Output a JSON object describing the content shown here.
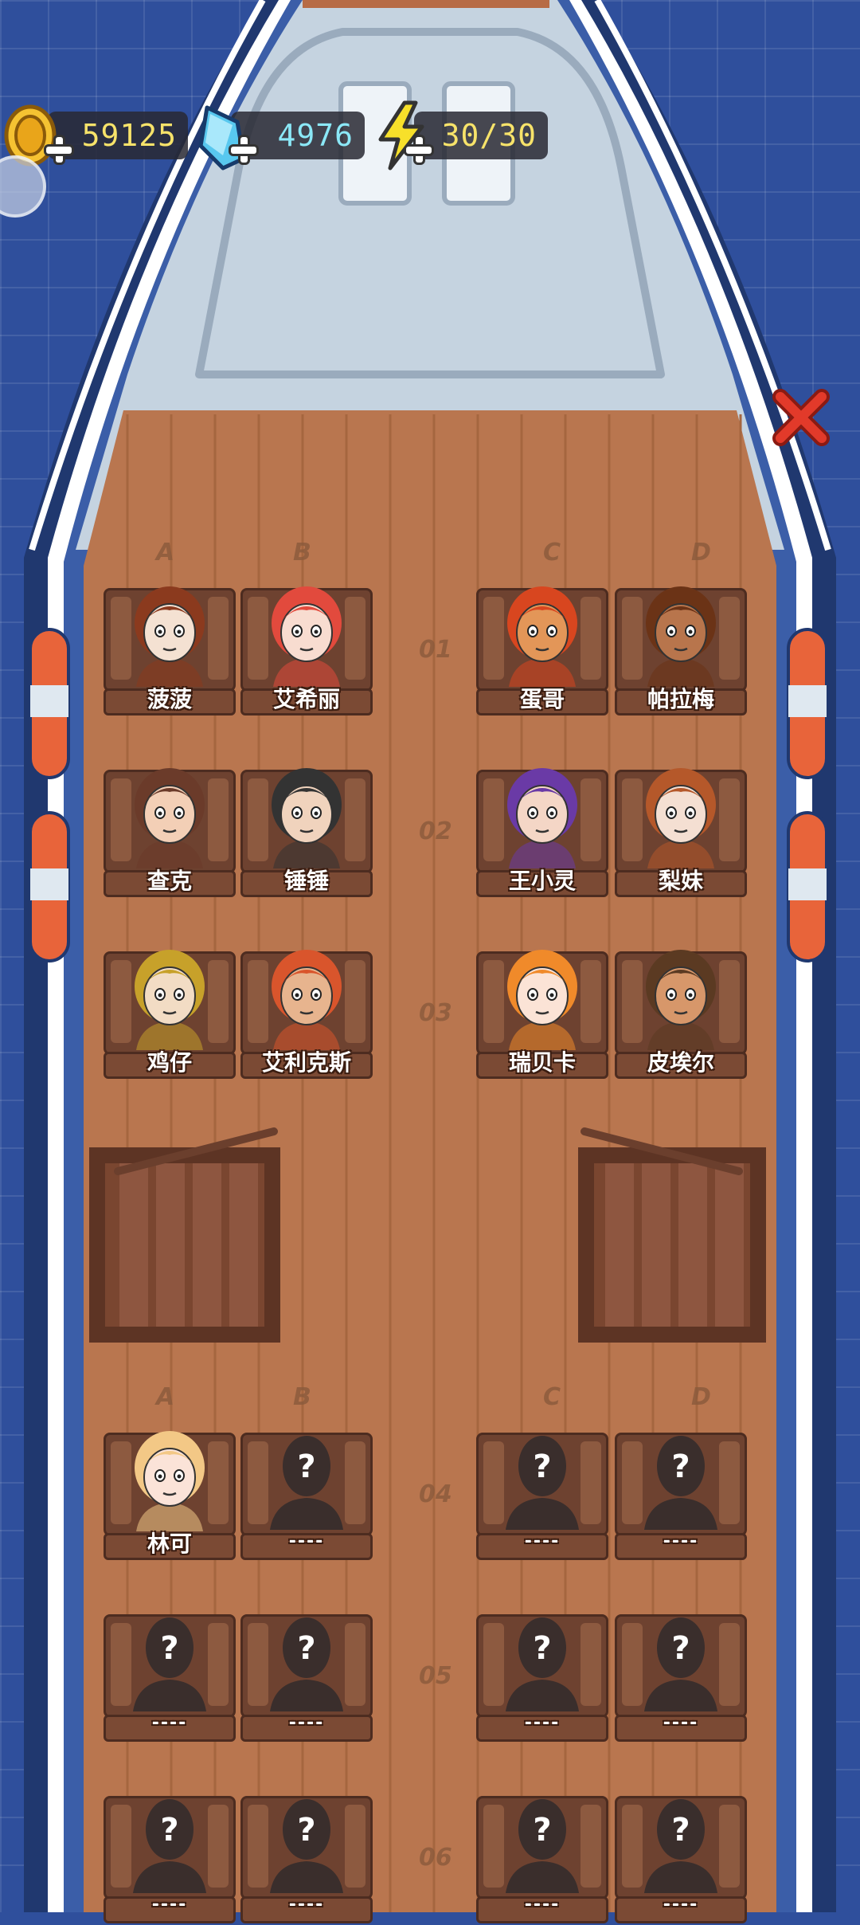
{
  "resources": {
    "coins": "59125",
    "gems": "4976",
    "energy": "30/30"
  },
  "deck": {
    "columns_top": [
      "A",
      "B",
      "C",
      "D"
    ],
    "columns_bottom": [
      "A",
      "B",
      "C",
      "D"
    ],
    "rows": [
      "01",
      "02",
      "03",
      "04",
      "05",
      "06"
    ],
    "seats": [
      {
        "row": "01",
        "col": "A",
        "name": "菠菠",
        "hair": "#8b3a1e",
        "skin": "#f4e1d2",
        "locked": false
      },
      {
        "row": "01",
        "col": "B",
        "name": "艾希丽",
        "hair": "#e24a3d",
        "skin": "#f8dcd0",
        "locked": false
      },
      {
        "row": "01",
        "col": "C",
        "name": "蛋哥",
        "hair": "#d8461f",
        "skin": "#e39658",
        "locked": false
      },
      {
        "row": "01",
        "col": "D",
        "name": "帕拉梅",
        "hair": "#6b3316",
        "skin": "#b8754c",
        "locked": false
      },
      {
        "row": "02",
        "col": "A",
        "name": "查克",
        "hair": "#6b3b2a",
        "skin": "#f3cfb6",
        "locked": false
      },
      {
        "row": "02",
        "col": "B",
        "name": "锤锤",
        "hair": "#333333",
        "skin": "#f0d3bd",
        "locked": false
      },
      {
        "row": "02",
        "col": "C",
        "name": "王小灵",
        "hair": "#6a3aa6",
        "skin": "#f4d6c6",
        "locked": false
      },
      {
        "row": "02",
        "col": "D",
        "name": "梨妹",
        "hair": "#b5582a",
        "skin": "#f4dfd2",
        "locked": false
      },
      {
        "row": "03",
        "col": "A",
        "name": "鸡仔",
        "hair": "#c7a12a",
        "skin": "#f2dcc4",
        "locked": false
      },
      {
        "row": "03",
        "col": "B",
        "name": "艾利克斯",
        "hair": "#d9552c",
        "skin": "#e7b48e",
        "locked": false
      },
      {
        "row": "03",
        "col": "C",
        "name": "瑞贝卡",
        "hair": "#f08a2a",
        "skin": "#fbe3d6",
        "locked": false
      },
      {
        "row": "03",
        "col": "D",
        "name": "皮埃尔",
        "hair": "#5b3a22",
        "skin": "#d7976a",
        "locked": false
      },
      {
        "row": "04",
        "col": "A",
        "name": "林可",
        "hair": "#f3c886",
        "skin": "#fbe3d8",
        "locked": false
      },
      {
        "row": "04",
        "col": "B",
        "name": "----",
        "locked": true
      },
      {
        "row": "04",
        "col": "C",
        "name": "----",
        "locked": true
      },
      {
        "row": "04",
        "col": "D",
        "name": "----",
        "locked": true
      },
      {
        "row": "05",
        "col": "A",
        "name": "----",
        "locked": true
      },
      {
        "row": "05",
        "col": "B",
        "name": "----",
        "locked": true
      },
      {
        "row": "05",
        "col": "C",
        "name": "----",
        "locked": true
      },
      {
        "row": "05",
        "col": "D",
        "name": "----",
        "locked": true
      },
      {
        "row": "06",
        "col": "A",
        "name": "----",
        "locked": true
      },
      {
        "row": "06",
        "col": "B",
        "name": "----",
        "locked": true
      },
      {
        "row": "06",
        "col": "C",
        "name": "----",
        "locked": true
      },
      {
        "row": "06",
        "col": "D",
        "name": "----",
        "locked": true
      }
    ]
  },
  "icons": {
    "coin": "coin-icon",
    "gem": "gem-icon",
    "energy": "lightning-icon",
    "close": "close-icon",
    "unknown": "question-mark-icon"
  },
  "colors": {
    "water": "#2f4f9c",
    "deck_wood": "#b9764f",
    "ship_grey": "#c5d3e0",
    "close_red": "#e23a2a"
  }
}
